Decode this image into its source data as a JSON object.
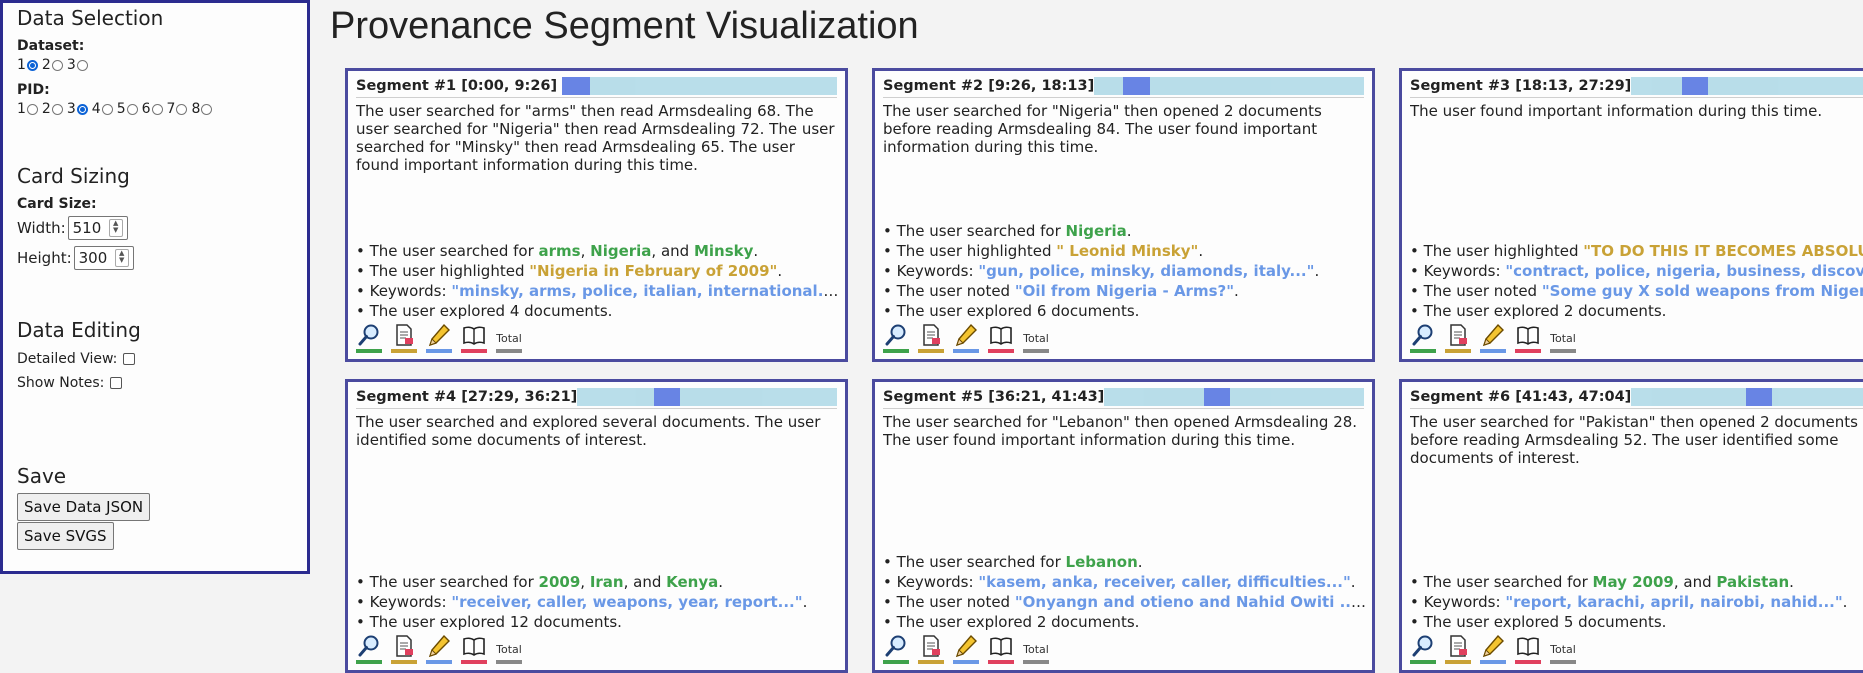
{
  "sidebar": {
    "data_selection": {
      "title": "Data Selection",
      "dataset_label": "Dataset:",
      "dataset_options": [
        "1",
        "2",
        "3"
      ],
      "dataset_selected": "1",
      "pid_label": "PID:",
      "pid_options": [
        "1",
        "2",
        "3",
        "4",
        "5",
        "6",
        "7",
        "8"
      ],
      "pid_selected": "3"
    },
    "card_sizing": {
      "title": "Card Sizing",
      "card_size_label": "Card Size:",
      "width_label": "Width:",
      "width_value": "510",
      "height_label": "Height:",
      "height_value": "300"
    },
    "data_editing": {
      "title": "Data Editing",
      "detailed_view_label": "Detailed View:",
      "show_notes_label": "Show Notes:"
    },
    "save": {
      "title": "Save",
      "save_json_label": "Save Data JSON",
      "save_svgs_label": "Save SVGS"
    }
  },
  "page": {
    "title": "Provenance Segment Visualization"
  },
  "colors": {
    "search": "#3ea24b",
    "highlight": "#c9a236",
    "keyword": "#6a98e6",
    "note": "#e0405e",
    "total": "#888888",
    "border": "#4b4b9f"
  },
  "icon_labels": {
    "total": "Total"
  },
  "cards": [
    {
      "title": "Segment #1 [0:00, 9:26]",
      "timeline": {
        "start": 0.0,
        "end": 0.085
      },
      "summary": "The user searched for \"arms\" then read Armsdealing 68. The user searched for \"Nigeria\" then read Armsdealing 72. The user searched for \"Minsky\" then read Armsdealing 65. The user found important information during this time.",
      "searched_prefix": "• The user searched for ",
      "searched": [
        "arms",
        "Nigeria",
        "Minsky"
      ],
      "highlight": "\"Nigeria in February of 2009\"",
      "keywords": "\"minsky, arms, police, italian, international...\"",
      "note": null,
      "explored": "• The user explored 4 documents.",
      "icon_bars": {
        "search": 0.85,
        "doc": 0.85,
        "highlight": 0.85,
        "note": 0.85,
        "total": 0.85
      }
    },
    {
      "title": "Segment #2 [9:26, 18:13]",
      "timeline": {
        "start": 0.105,
        "end": 0.2
      },
      "summary": "The user searched for \"Nigeria\" then opened 2 documents before reading Armsdealing 84. The user found important information during this time.",
      "searched_prefix": "• The user searched for ",
      "searched": [
        "Nigeria"
      ],
      "highlight": "\" Leonid Minsky\"",
      "keywords": "\"gun, police, minsky, diamonds, italy...\"",
      "note": "\"Oil from Nigeria - Arms?\"",
      "explored": "• The user explored 6 documents.",
      "icon_bars": {
        "search": 0.85,
        "doc": 0.85,
        "highlight": 0.85,
        "note": 0.85,
        "total": 0.85
      }
    },
    {
      "title": "Segment #3 [18:13, 27:29]",
      "timeline": {
        "start": 0.195,
        "end": 0.29
      },
      "summary": "The user found important information during this time.",
      "searched_prefix": "",
      "searched": [],
      "highlight": "\"TO DO THIS IT BECOMES ABSOLUTELY NE...",
      "keywords": "\"contract, police, nigeria, business, discovered...\"",
      "note": "\"Some guy X sold weapons from Nigeri...\"",
      "explored": "• The user explored 2 documents.",
      "icon_bars": {
        "search": 0.85,
        "doc": 0.85,
        "highlight": 0.85,
        "note": 0.85,
        "total": 0.85
      }
    },
    {
      "title": "Segment #4 [27:29, 36:21]",
      "timeline": {
        "start": 0.295,
        "end": 0.385
      },
      "summary": "The user searched and explored several documents. The user identified some documents of interest.",
      "searched_prefix": "• The user searched for ",
      "searched": [
        "2009",
        "Iran",
        "Kenya"
      ],
      "highlight": null,
      "keywords": "\"receiver, caller, weapons, year, report...\"",
      "note": null,
      "explored": "• The user explored 12 documents.",
      "icon_bars": {
        "search": 0.85,
        "doc": 0.85,
        "highlight": 0.85,
        "note": 0.85,
        "total": 0.85
      }
    },
    {
      "title": "Segment #5 [36:21, 41:43]",
      "timeline": {
        "start": 0.385,
        "end": 0.44
      },
      "summary": "The user searched for \"Lebanon\" then opened Armsdealing 28. The user found important information during this time.",
      "searched_prefix": "• The user searched for ",
      "searched": [
        "Lebanon"
      ],
      "highlight": null,
      "keywords": "\"kasem, anka, receiver, caller, difficulties...\"",
      "note": "\"Onyangn and otieno and Nahid Owiti ...\"",
      "explored": "• The user explored 2 documents.",
      "icon_bars": {
        "search": 0.85,
        "doc": 0.85,
        "highlight": 0.85,
        "note": 0.85,
        "total": 0.85
      }
    },
    {
      "title": "Segment #6 [41:43, 47:04]",
      "timeline": {
        "start": 0.44,
        "end": 0.5
      },
      "summary": "The user searched for \"Pakistan\" then opened 2 documents before reading Armsdealing 52. The user identified some documents of interest.",
      "searched_prefix": "• The user searched for ",
      "searched": [
        "May 2009",
        "Pakistan"
      ],
      "highlight": null,
      "keywords": "\"report, karachi, april, nairobi, nahid...\"",
      "note": null,
      "explored": "• The user explored 5 documents.",
      "icon_bars": {
        "search": 0.85,
        "doc": 0.85,
        "highlight": 0.85,
        "note": 0.85,
        "total": 0.85
      }
    }
  ]
}
